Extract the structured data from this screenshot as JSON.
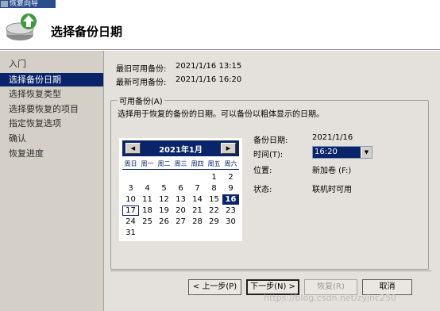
{
  "window": {
    "title": "恢复向导"
  },
  "header": {
    "title": "选择备份日期"
  },
  "nav": {
    "items": [
      {
        "label": "入门",
        "active": false
      },
      {
        "label": "选择备份日期",
        "active": true
      },
      {
        "label": "选择恢复类型",
        "active": false
      },
      {
        "label": "选择要恢复的项目",
        "active": false
      },
      {
        "label": "指定恢复选项",
        "active": false
      },
      {
        "label": "确认",
        "active": false
      },
      {
        "label": "恢复进度",
        "active": false
      }
    ]
  },
  "info": {
    "oldest_label": "最旧可用备份:",
    "oldest_value": "2021/1/16 13:15",
    "newest_label": "最新可用备份:",
    "newest_value": "2021/1/16 16:20"
  },
  "available": {
    "legend": "可用备份(A)",
    "description": "选择用于恢复的备份的日期。可以备份以粗体显示的日期。"
  },
  "calendar": {
    "prev_icon": "left-arrow-icon",
    "next_icon": "right-arrow-icon",
    "prev_glyph": "◀",
    "next_glyph": "▶",
    "month_label": "2021年1月",
    "weekdays": [
      "周日",
      "周一",
      "周二",
      "周三",
      "周四",
      "周五",
      "周六"
    ],
    "selected_day": 16,
    "today_day": 17,
    "weeks": [
      [
        "",
        "",
        "",
        "",
        "",
        "1",
        "2"
      ],
      [
        "3",
        "4",
        "5",
        "6",
        "7",
        "8",
        "9"
      ],
      [
        "10",
        "11",
        "12",
        "13",
        "14",
        "15",
        "16"
      ],
      [
        "17",
        "18",
        "19",
        "20",
        "21",
        "22",
        "23"
      ],
      [
        "24",
        "25",
        "26",
        "27",
        "28",
        "29",
        "30"
      ],
      [
        "31",
        "",
        "",
        "",
        "",
        "",
        ""
      ]
    ]
  },
  "details": {
    "date_label": "备份日期:",
    "date_value": "2021/1/16",
    "time_label": "时间(T):",
    "time_value": "16:20",
    "time_arrow": "▼",
    "location_label": "位置:",
    "location_value": "新加卷 (F:)",
    "status_label": "状态:",
    "status_value": "联机时可用"
  },
  "buttons": {
    "back": "< 上一步(P)",
    "next": "下一步(N) >",
    "recover": "恢复(R)",
    "cancel": "取消"
  },
  "watermark": "https://blog.csdn.net/zyjnc250"
}
